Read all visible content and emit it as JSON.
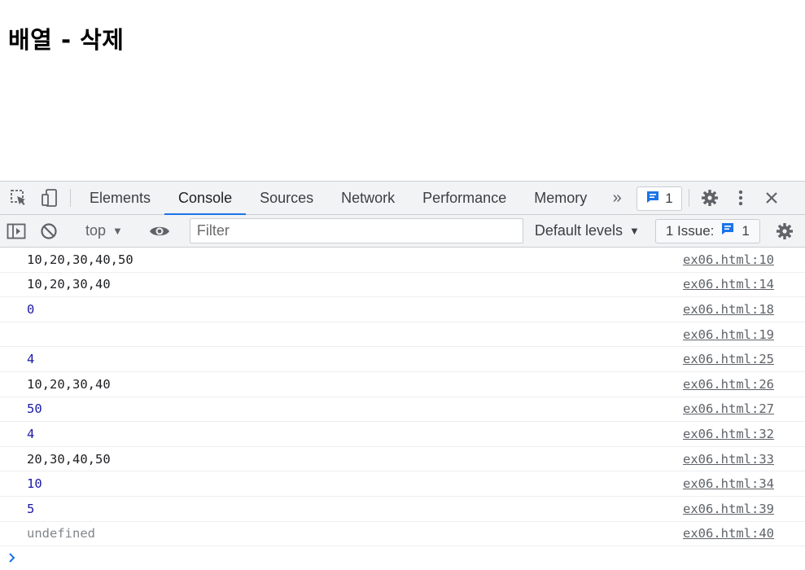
{
  "page": {
    "heading": "배열 - 삭제"
  },
  "devtools": {
    "tabs": [
      "Elements",
      "Console",
      "Sources",
      "Network",
      "Performance",
      "Memory"
    ],
    "active_tab": "Console",
    "issue_count": "1",
    "toolbar": {
      "context": "top",
      "filter_placeholder": "Filter",
      "default_levels": "Default levels",
      "issues_label": "1 Issue:",
      "issues_count": "1"
    }
  },
  "console": {
    "rows": [
      {
        "message": "10,20,30,40,50",
        "kind": "string",
        "source": "ex06.html:10"
      },
      {
        "message": "10,20,30,40",
        "kind": "string",
        "source": "ex06.html:14"
      },
      {
        "message": "0",
        "kind": "number",
        "source": "ex06.html:18"
      },
      {
        "message": "",
        "kind": "string",
        "source": "ex06.html:19"
      },
      {
        "message": "4",
        "kind": "number",
        "source": "ex06.html:25"
      },
      {
        "message": "10,20,30,40",
        "kind": "string",
        "source": "ex06.html:26"
      },
      {
        "message": "50",
        "kind": "number",
        "source": "ex06.html:27"
      },
      {
        "message": "4",
        "kind": "number",
        "source": "ex06.html:32"
      },
      {
        "message": "20,30,40,50",
        "kind": "string",
        "source": "ex06.html:33"
      },
      {
        "message": "10",
        "kind": "number",
        "source": "ex06.html:34"
      },
      {
        "message": "5",
        "kind": "number",
        "source": "ex06.html:39"
      },
      {
        "message": "undefined",
        "kind": "undef",
        "source": "ex06.html:40"
      }
    ]
  },
  "colors": {
    "accent": "#1a73e8",
    "number": "#1a1aa6",
    "panel_bg": "#f1f3f4"
  },
  "icons": [
    "inspect-element-icon",
    "device-toolbar-icon",
    "chevron-double-right-icon",
    "message-icon",
    "gear-icon",
    "kebab-menu-icon",
    "close-icon",
    "sidebar-toggle-icon",
    "clear-console-icon",
    "eye-icon",
    "dropdown-triangle-icon",
    "prompt-chevron-icon"
  ]
}
